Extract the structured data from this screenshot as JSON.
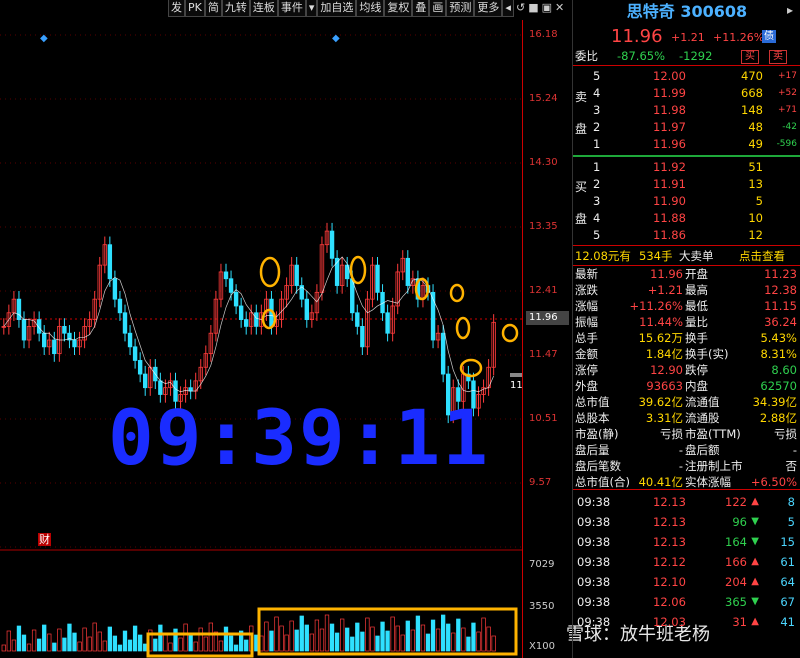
{
  "toolbar": [
    "发",
    "PK",
    "简",
    "九转",
    "连板",
    "事件",
    "▾",
    "加自选",
    "均线",
    "复权",
    "叠",
    "画",
    "预测",
    "更多",
    "◂"
  ],
  "window_controls": [
    "↺",
    "■",
    "▣",
    "✕"
  ],
  "price_axis": [
    "16.18",
    "15.24",
    "14.30",
    "13.35",
    "12.41",
    "11.96",
    "11.47",
    "10.51",
    "9.57"
  ],
  "volume_axis": [
    "7029",
    "3550",
    "X100"
  ],
  "clock": "09:39:11",
  "chart_marks": {
    "financial_badge": "财",
    "last_price_small": "11."
  },
  "watermark": "雪球：放牛班老杨",
  "stock": {
    "name": "思特奇",
    "code": "300608",
    "price": "11.96",
    "change": "+1.21",
    "change_pct": "+11.26%",
    "tag": "债"
  },
  "weibi": {
    "label": "委比",
    "pct": "-87.65%",
    "diff": "-1292",
    "buy": "买",
    "sell": "卖"
  },
  "sell_label": [
    "卖",
    "盘"
  ],
  "buy_label": [
    "买",
    "盘"
  ],
  "sell_orders": [
    {
      "level": "5",
      "price": "12.00",
      "vol": "470",
      "chg": "+17"
    },
    {
      "level": "4",
      "price": "11.99",
      "vol": "668",
      "chg": "+52"
    },
    {
      "level": "3",
      "price": "11.98",
      "vol": "148",
      "chg": "+71"
    },
    {
      "level": "2",
      "price": "11.97",
      "vol": "48",
      "chg": "-42"
    },
    {
      "level": "1",
      "price": "11.96",
      "vol": "49",
      "chg": "-596"
    }
  ],
  "buy_orders": [
    {
      "level": "1",
      "price": "11.92",
      "vol": "51"
    },
    {
      "level": "2",
      "price": "11.91",
      "vol": "13"
    },
    {
      "level": "3",
      "price": "11.90",
      "vol": "5"
    },
    {
      "level": "4",
      "price": "11.88",
      "vol": "10"
    },
    {
      "level": "5",
      "price": "11.86",
      "vol": "12"
    }
  ],
  "big_order": {
    "price": "12.08元有",
    "vol": "534手",
    "label": "大卖单",
    "action": "点击查看"
  },
  "stats": [
    {
      "l1": "最新",
      "v1": "11.96",
      "c1": "red",
      "l2": "开盘",
      "v2": "11.23",
      "c2": "red"
    },
    {
      "l1": "涨跌",
      "v1": "+1.21",
      "c1": "red",
      "l2": "最高",
      "v2": "12.38",
      "c2": "red"
    },
    {
      "l1": "涨幅",
      "v1": "+11.26%",
      "c1": "red",
      "l2": "最低",
      "v2": "11.15",
      "c2": "red"
    },
    {
      "l1": "振幅",
      "v1": "11.44%",
      "c1": "red",
      "l2": "量比",
      "v2": "36.24",
      "c2": "red"
    },
    {
      "l1": "总手",
      "v1": "15.62万",
      "c1": "yellow",
      "l2": "换手",
      "v2": "5.43%",
      "c2": "yellow"
    },
    {
      "l1": "金额",
      "v1": "1.84亿",
      "c1": "yellow",
      "l2": "换手(实)",
      "v2": "8.31%",
      "c2": "yellow"
    },
    {
      "l1": "涨停",
      "v1": "12.90",
      "c1": "red",
      "l2": "跌停",
      "v2": "8.60",
      "c2": "green"
    },
    {
      "l1": "外盘",
      "v1": "93663",
      "c1": "red",
      "l2": "内盘",
      "v2": "62570",
      "c2": "green"
    },
    {
      "l1": "总市值",
      "v1": "39.62亿",
      "c1": "yellow",
      "l2": "流通值",
      "v2": "34.39亿",
      "c2": "yellow"
    },
    {
      "l1": "总股本",
      "v1": "3.31亿",
      "c1": "yellow",
      "l2": "流通股",
      "v2": "2.88亿",
      "c2": "yellow"
    },
    {
      "l1": "市盈(静)",
      "v1": "亏损",
      "c1": "white",
      "l2": "市盈(TTM)",
      "v2": "亏损",
      "c2": "white"
    },
    {
      "l1": "盘后量",
      "v1": "-",
      "c1": "white",
      "l2": "盘后额",
      "v2": "-",
      "c2": "white"
    },
    {
      "l1": "盘后笔数",
      "v1": "-",
      "c1": "white",
      "l2": "注册制上市",
      "v2": "否",
      "c2": "white"
    },
    {
      "l1": "总市值(合)",
      "v1": "40.41亿",
      "c1": "yellow",
      "l2": "实体涨幅",
      "v2": "+6.50%",
      "c2": "red"
    }
  ],
  "ticks": [
    {
      "time": "09:38",
      "price": "12.13",
      "vol": "122",
      "dir": "up",
      "n": "8"
    },
    {
      "time": "09:38",
      "price": "12.13",
      "vol": "96",
      "dir": "down",
      "n": "5"
    },
    {
      "time": "09:38",
      "price": "12.13",
      "vol": "164",
      "dir": "down",
      "n": "15"
    },
    {
      "time": "09:38",
      "price": "12.12",
      "vol": "166",
      "dir": "up",
      "n": "61"
    },
    {
      "time": "09:38",
      "price": "12.10",
      "vol": "204",
      "dir": "up",
      "n": "64"
    },
    {
      "time": "09:38",
      "price": "12.06",
      "vol": "365",
      "dir": "down",
      "n": "67"
    },
    {
      "time": "09:38",
      "price": "12.03",
      "vol": "31",
      "dir": "up",
      "n": "41"
    }
  ],
  "colors": {
    "up": "#ff4444",
    "down": "#2fd04f",
    "grid": "#7a0000",
    "axis": "#cc0000",
    "highlight": "#ffb300",
    "clock": "#1a2cff",
    "title": "#4cb1ff",
    "ma": "#ffffff"
  }
}
